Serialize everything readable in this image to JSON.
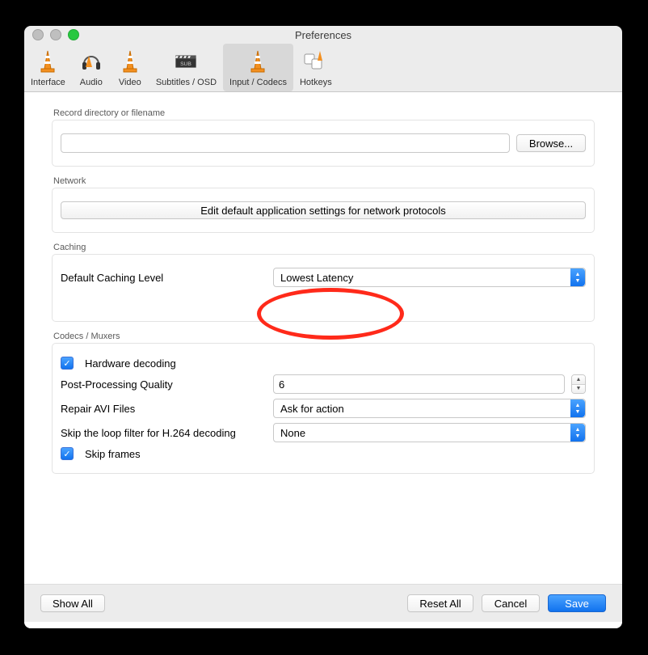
{
  "window_title": "Preferences",
  "toolbar": {
    "items": [
      {
        "label": "Interface"
      },
      {
        "label": "Audio"
      },
      {
        "label": "Video"
      },
      {
        "label": "Subtitles / OSD"
      },
      {
        "label": "Input / Codecs"
      },
      {
        "label": "Hotkeys"
      }
    ]
  },
  "groups": {
    "record": {
      "title": "Record directory or filename",
      "value": "",
      "browse": "Browse..."
    },
    "network": {
      "title": "Network",
      "button": "Edit default application settings for network protocols"
    },
    "caching": {
      "title": "Caching",
      "label": "Default Caching Level",
      "value": "Lowest Latency"
    },
    "codecs": {
      "title": "Codecs / Muxers",
      "hw_decoding": "Hardware decoding",
      "post_quality_label": "Post-Processing Quality",
      "post_quality_value": "6",
      "repair_label": "Repair AVI Files",
      "repair_value": "Ask for action",
      "skipfilter_label": "Skip the loop filter for H.264 decoding",
      "skipfilter_value": "None",
      "skip_frames": "Skip frames"
    }
  },
  "bottom": {
    "show_all": "Show All",
    "reset": "Reset All",
    "cancel": "Cancel",
    "save": "Save"
  }
}
